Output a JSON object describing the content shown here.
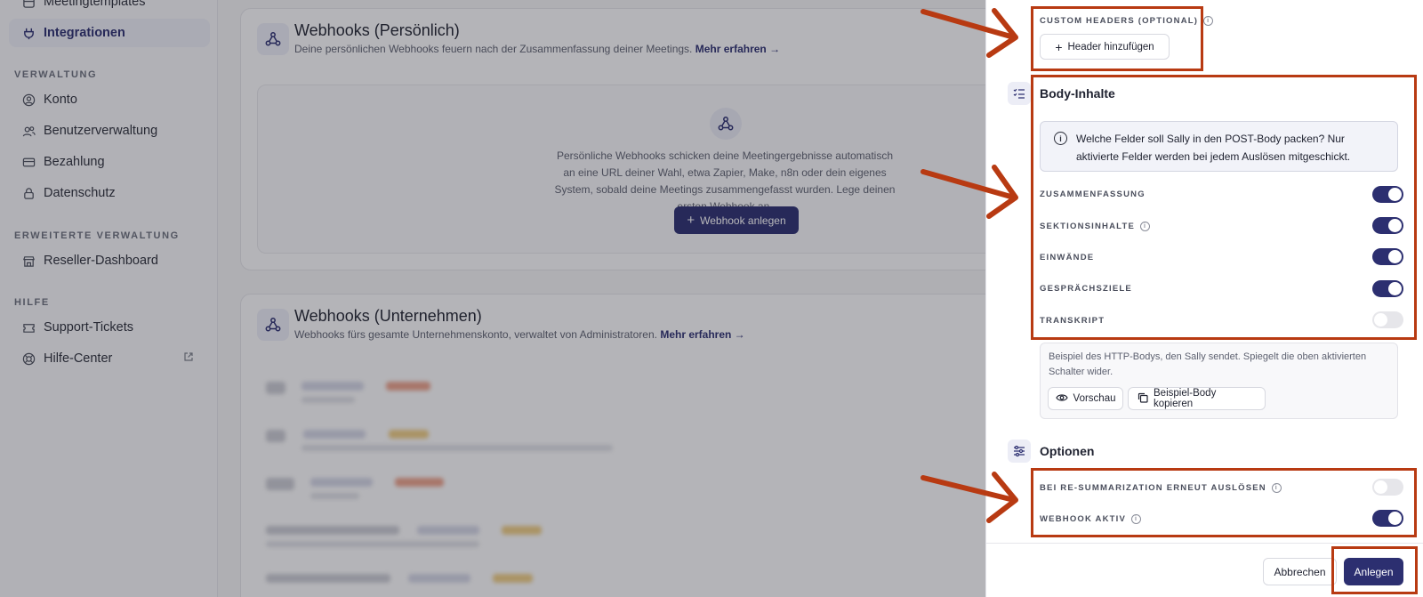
{
  "sidebar": {
    "items_top": [
      {
        "label": "Meetingtemplates",
        "icon": "template-icon"
      },
      {
        "label": "Integrationen",
        "icon": "plug-icon",
        "active": true
      }
    ],
    "section_verwaltung": "VERWALTUNG",
    "items_verwaltung": [
      {
        "label": "Konto",
        "icon": "user-circle-icon"
      },
      {
        "label": "Benutzerverwaltung",
        "icon": "users-icon"
      },
      {
        "label": "Bezahlung",
        "icon": "credit-card-icon"
      },
      {
        "label": "Datenschutz",
        "icon": "lock-icon"
      }
    ],
    "section_erweitert": "ERWEITERTE VERWALTUNG",
    "items_erweitert": [
      {
        "label": "Reseller-Dashboard",
        "icon": "store-icon"
      }
    ],
    "section_hilfe": "HILFE",
    "items_hilfe": [
      {
        "label": "Support-Tickets",
        "icon": "ticket-icon"
      },
      {
        "label": "Hilfe-Center",
        "icon": "lifebuoy-icon",
        "external": true
      }
    ]
  },
  "main": {
    "personal": {
      "title": "Webhooks (Persönlich)",
      "subtitle": "Deine persönlichen Webhooks feuern nach der Zusammenfassung deiner Meetings.",
      "link": "Mehr erfahren →",
      "empty_text": "Persönliche Webhooks schicken deine Meetingergebnisse automatisch an eine URL deiner Wahl, etwa Zapier, Make, n8n oder dein eigenes System, sobald deine Meetings zusammengefasst wurden. Lege deinen ersten Webhook an.",
      "create_button": "Webhook anlegen"
    },
    "company": {
      "title": "Webhooks (Unternehmen)",
      "subtitle": "Webhooks fürs gesamte Unternehmenskonto, verwaltet von Administratoren.",
      "link": "Mehr erfahren →"
    }
  },
  "drawer": {
    "custom_headers_label": "CUSTOM HEADERS (OPTIONAL)",
    "add_header_button": "Header hinzufügen",
    "body_section_title": "Body-Inhalte",
    "body_info": "Welche Felder soll Sally in den POST-Body packen? Nur aktivierte Felder werden bei jedem Auslösen mitgeschickt.",
    "fields": [
      {
        "label": "ZUSAMMENFASSUNG",
        "on": true,
        "info": false
      },
      {
        "label": "SEKTIONSINHALTE",
        "on": true,
        "info": true
      },
      {
        "label": "EINWÄNDE",
        "on": true,
        "info": false
      },
      {
        "label": "GESPRÄCHSZIELE",
        "on": true,
        "info": false
      },
      {
        "label": "TRANSKRIPT",
        "on": false,
        "info": false
      }
    ],
    "example_text": "Beispiel des HTTP-Bodys, den Sally sendet. Spiegelt die oben aktivierten Schalter wider.",
    "preview_button": "Vorschau",
    "copy_button": "Beispiel-Body kopieren",
    "options_title": "Optionen",
    "options": [
      {
        "label": "BEI RE-SUMMARIZATION ERNEUT AUSLÖSEN",
        "on": false
      },
      {
        "label": "WEBHOOK AKTIV",
        "on": true
      }
    ],
    "cancel_button": "Abbrechen",
    "create_button": "Anlegen"
  },
  "colors": {
    "primary": "#2c2f70",
    "annotation": "#b83a12"
  }
}
